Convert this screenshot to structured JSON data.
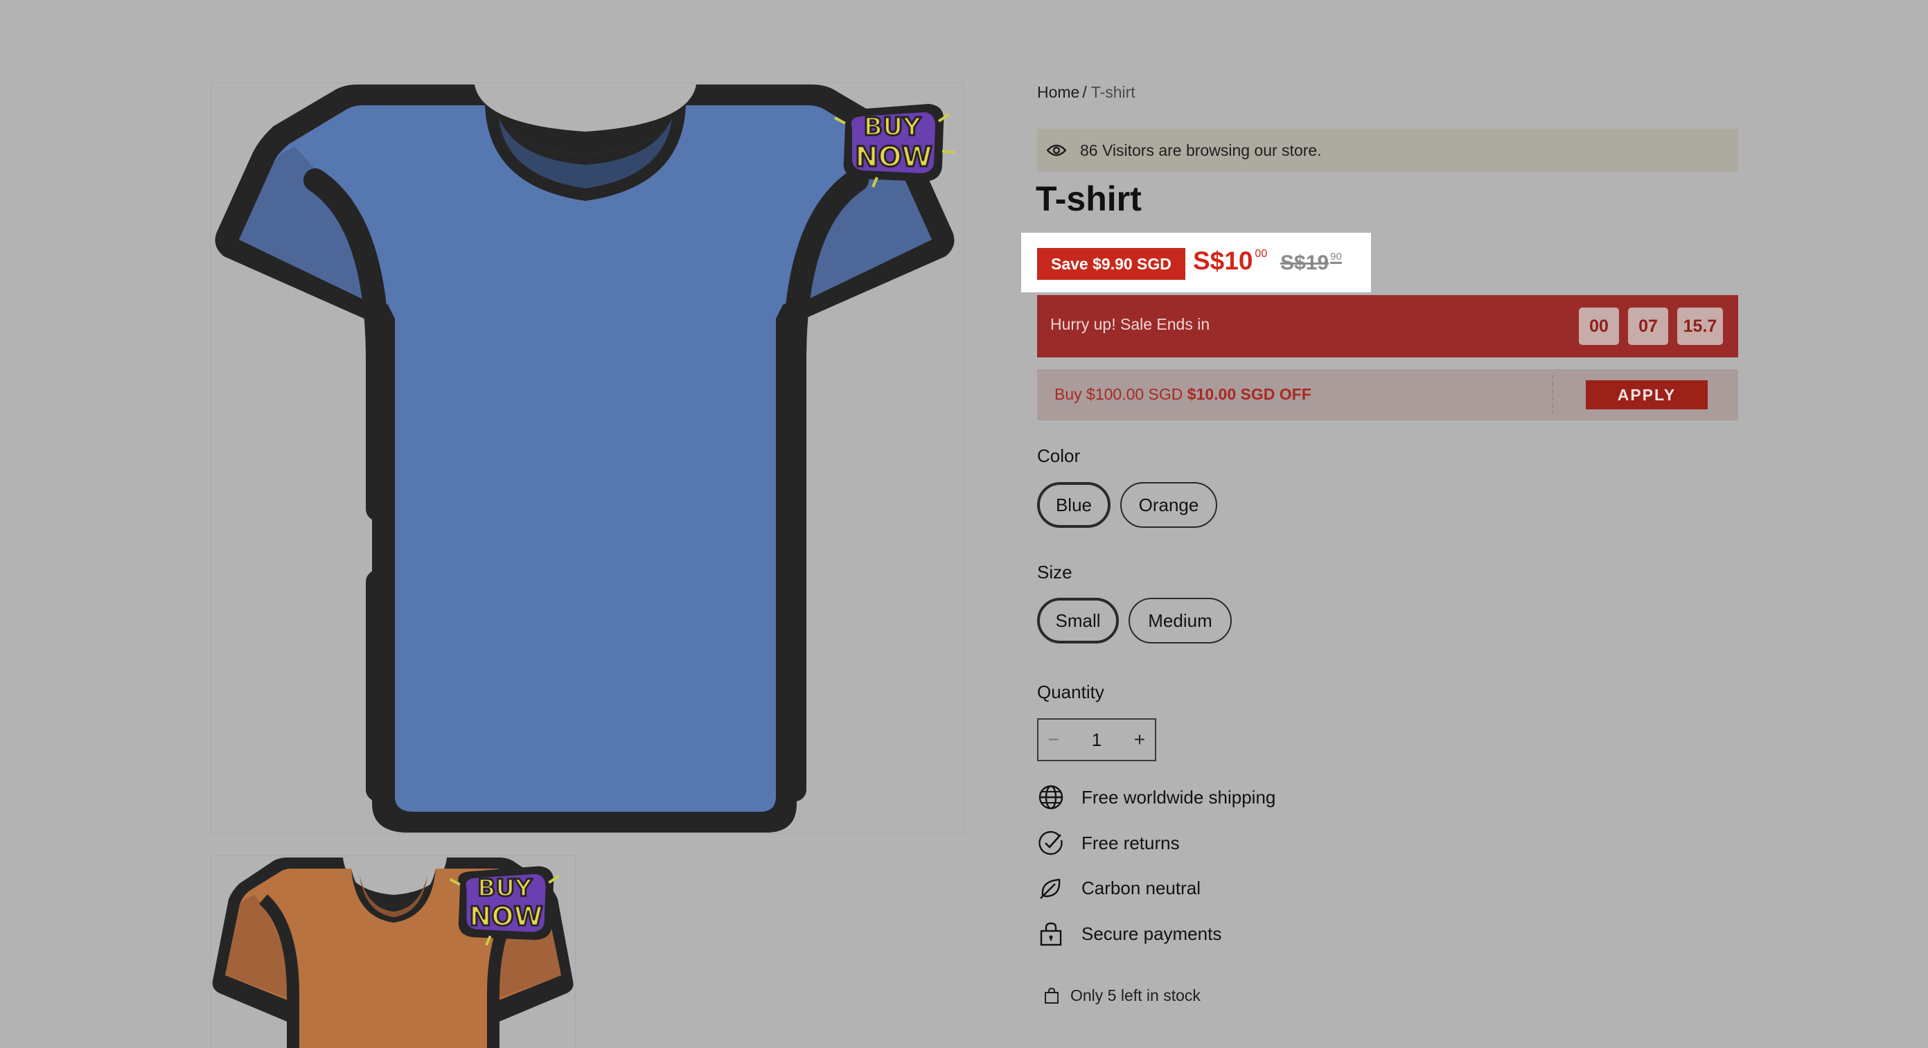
{
  "breadcrumb": {
    "home": "Home",
    "separator": "/",
    "current": "T-shirt"
  },
  "visitors": {
    "icon": "eye-icon",
    "text": "86 Visitors are browsing our store."
  },
  "product": {
    "title": "T-shirt",
    "save_badge": "Save $9.90 SGD",
    "price_main": "S$10",
    "price_cents": "00",
    "compare_main": "S$19",
    "compare_cents": "90"
  },
  "countdown": {
    "label": "Hurry up! Sale Ends in",
    "hours": "00",
    "minutes": "07",
    "seconds": "15.7"
  },
  "coupon": {
    "text": "Buy $100.00 SGD",
    "offer": "$10.00 SGD OFF",
    "button": "APPLY"
  },
  "color": {
    "label": "Color",
    "options": [
      "Blue",
      "Orange"
    ],
    "selected": "Blue"
  },
  "size": {
    "label": "Size",
    "options": [
      "Small",
      "Medium"
    ],
    "selected": "Small"
  },
  "quantity": {
    "label": "Quantity",
    "value": "1",
    "minus": "−",
    "plus": "+"
  },
  "features": [
    {
      "icon": "globe-icon",
      "label": "Free worldwide shipping"
    },
    {
      "icon": "check-circle-icon",
      "label": "Free returns"
    },
    {
      "icon": "leaf-icon",
      "label": "Carbon neutral"
    },
    {
      "icon": "lock-icon",
      "label": "Secure payments"
    }
  ],
  "stock": {
    "icon": "bag-icon",
    "text": "Only 5 left in stock"
  },
  "media": {
    "main_sticker": [
      "BUY",
      "NOW"
    ],
    "thumb_sticker": [
      "BUY",
      "NOW"
    ],
    "colors": {
      "blue": "#5677b0",
      "orange": "#b87340",
      "outline": "#252525",
      "sticker_purple": "#6a3fb0",
      "sticker_text": "#e8d24a"
    }
  }
}
